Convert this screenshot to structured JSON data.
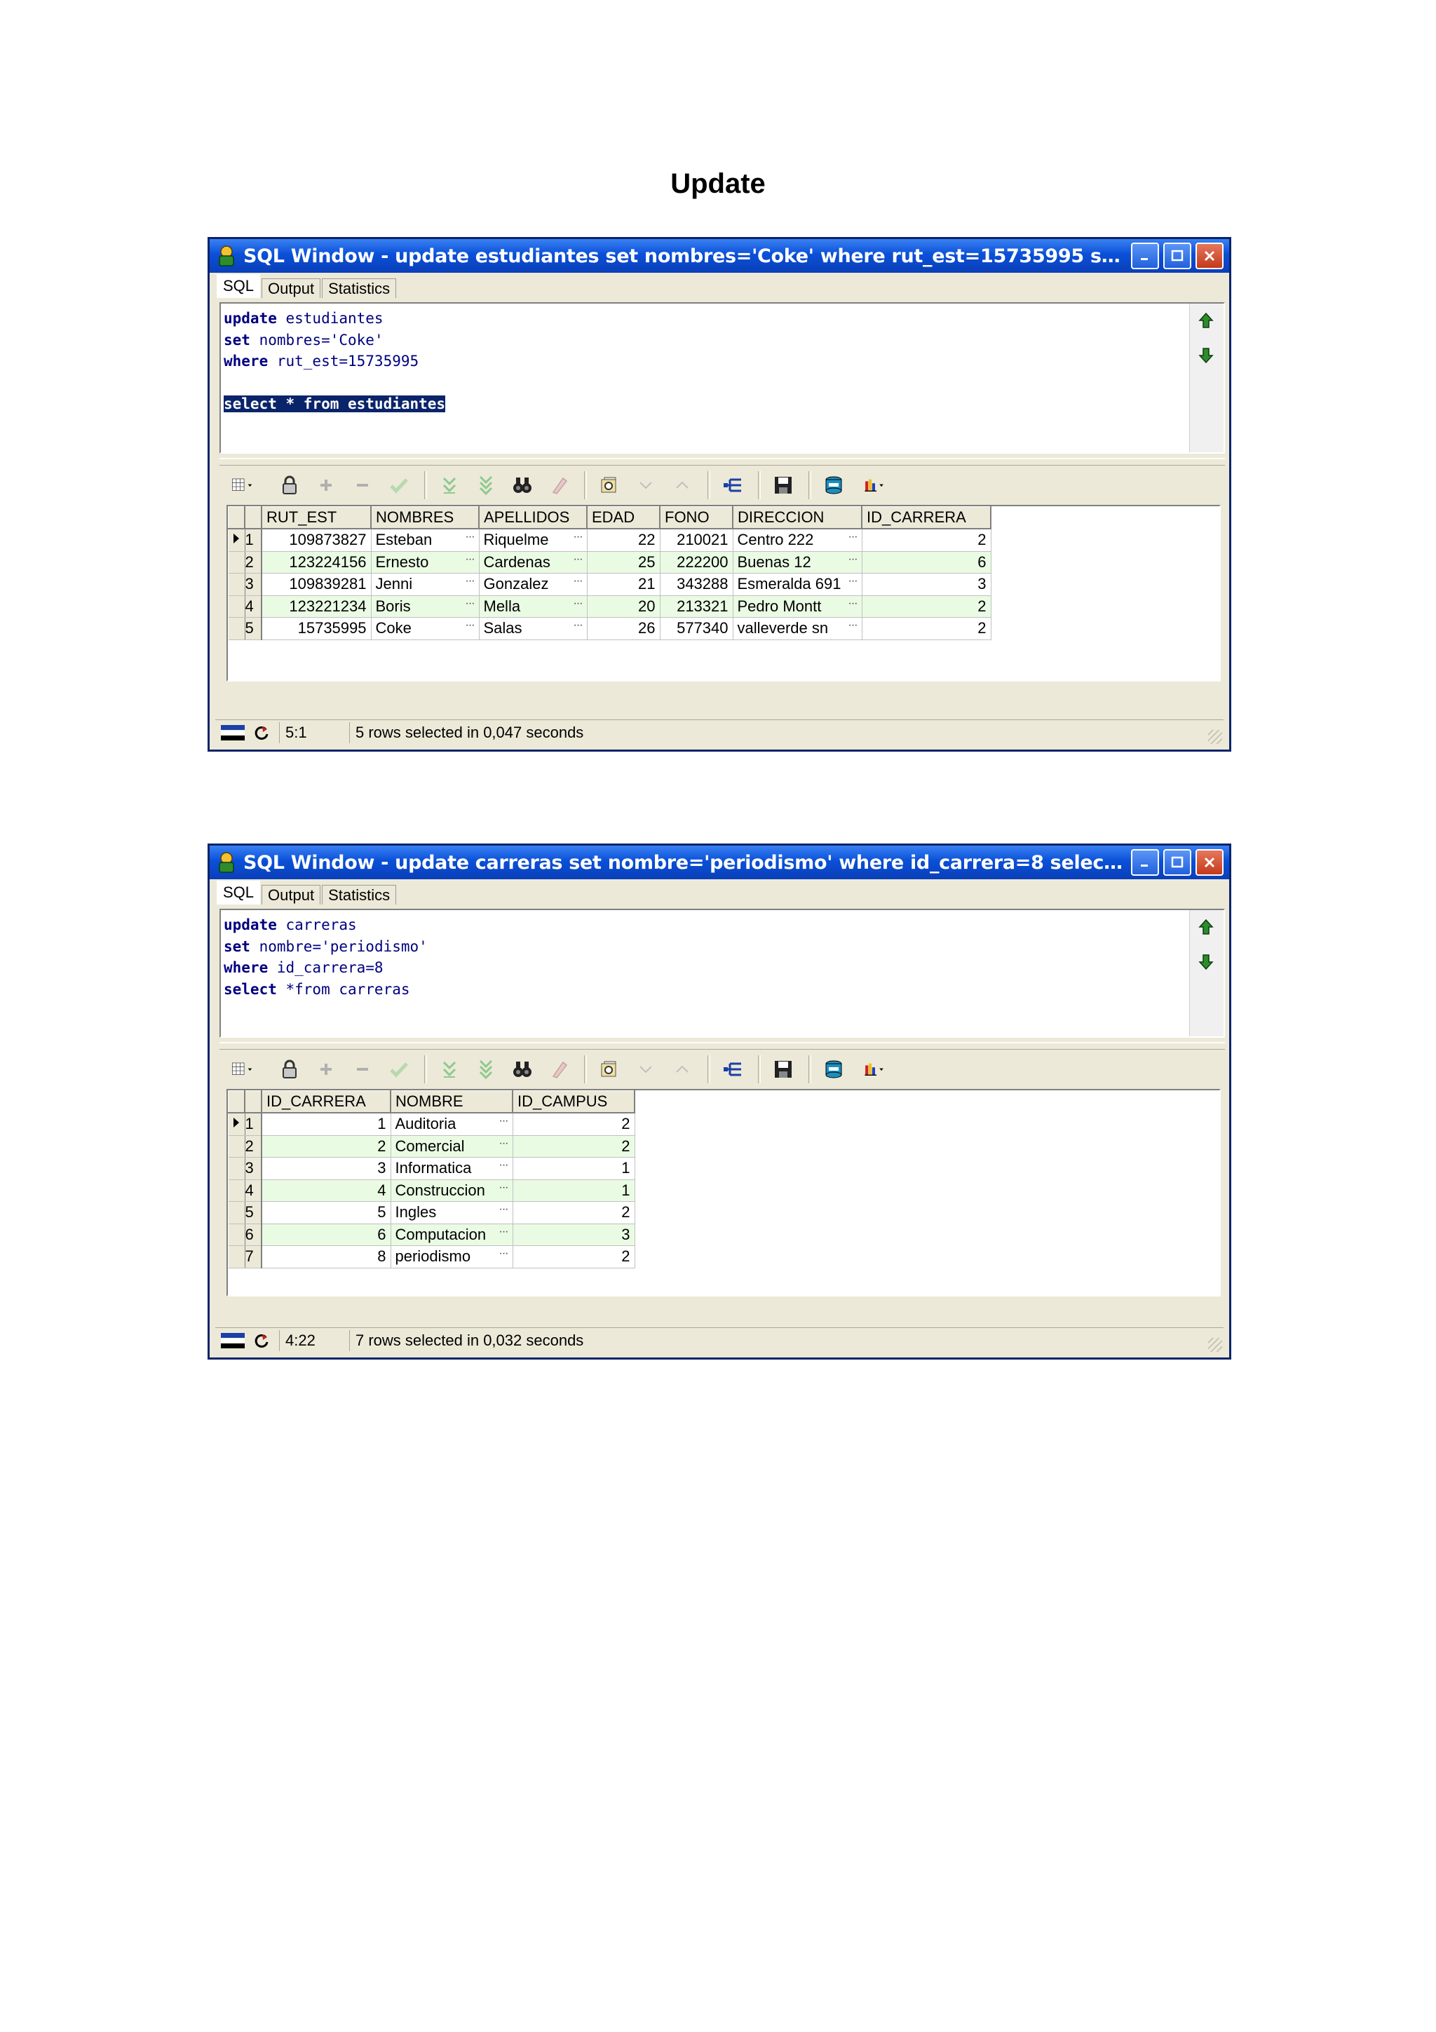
{
  "doc_title": "Update",
  "windows": [
    {
      "title": "SQL Window - update estudiantes set nombres='Coke' where rut_est=15735995 select * from est…",
      "tabs": [
        "SQL",
        "Output",
        "Statistics"
      ],
      "code_lines": [
        {
          "kw": "update",
          "rest": " estudiantes"
        },
        {
          "kw": "set",
          "rest": " nombres='Coke'"
        },
        {
          "kw": "where",
          "rest": " rut_est=15735995"
        },
        {
          "kw": "",
          "rest": ""
        },
        {
          "selected": "select * from estudiantes"
        }
      ],
      "columns": [
        "RUT_EST",
        "NOMBRES",
        "APELLIDOS",
        "EDAD",
        "FONO",
        "DIRECCION",
        "ID_CARRERA"
      ],
      "rows": [
        [
          "1",
          "109873827",
          "Esteban",
          "Riquelme",
          "22",
          "210021",
          "Centro 222",
          "2"
        ],
        [
          "2",
          "123224156",
          "Ernesto",
          "Cardenas",
          "25",
          "222200",
          "Buenas 12",
          "6"
        ],
        [
          "3",
          "109839281",
          "Jenni",
          "Gonzalez",
          "21",
          "343288",
          "Esmeralda 691",
          "3"
        ],
        [
          "4",
          "123221234",
          "Boris",
          "Mella",
          "20",
          "213321",
          "Pedro Montt",
          "2"
        ],
        [
          "5",
          "15735995",
          "Coke",
          "Salas",
          "26",
          "577340",
          "valleverde sn",
          "2"
        ]
      ],
      "status_pos": "5:1",
      "status_msg": "5 rows selected in 0,047 seconds"
    },
    {
      "title": "SQL Window - update carreras set nombre='periodismo' where id_carrera=8 select *from carreras",
      "tabs": [
        "SQL",
        "Output",
        "Statistics"
      ],
      "code_lines": [
        {
          "kw": "update",
          "rest": " carreras"
        },
        {
          "kw": "set",
          "rest": " nombre='periodismo'"
        },
        {
          "kw": "where",
          "rest": " id_carrera=8"
        },
        {
          "kw": "select",
          "rest": " *from carreras"
        }
      ],
      "columns": [
        "ID_CARRERA",
        "NOMBRE",
        "ID_CAMPUS"
      ],
      "rows": [
        [
          "1",
          "1",
          "Auditoria",
          "2"
        ],
        [
          "2",
          "2",
          "Comercial",
          "2"
        ],
        [
          "3",
          "3",
          "Informatica",
          "1"
        ],
        [
          "4",
          "4",
          "Construccion",
          "1"
        ],
        [
          "5",
          "5",
          "Ingles",
          "2"
        ],
        [
          "6",
          "6",
          "Computacion",
          "3"
        ],
        [
          "7",
          "8",
          "periodismo",
          "2"
        ]
      ],
      "status_pos": "4:22",
      "status_msg": "7 rows selected in 0,032 seconds"
    }
  ],
  "colors": {
    "titlebar": "#0a50d8",
    "grid_alt_row": "#eafbe4",
    "sql_keyword": "#000080",
    "selection": "#0a246a"
  }
}
